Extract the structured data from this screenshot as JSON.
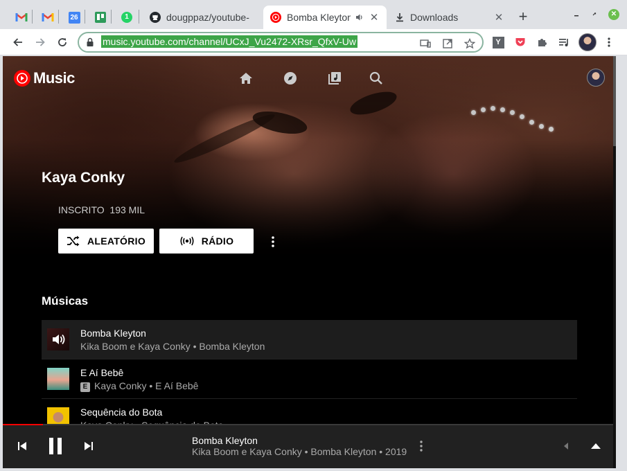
{
  "browser": {
    "tabs": [
      {
        "title": "dougppaz/youtube-",
        "icon": "github-icon"
      },
      {
        "title": "Bomba Kleyton",
        "icon": "youtube-music-icon",
        "audio_icon": "speaker-icon"
      },
      {
        "title": "Downloads",
        "icon": "download-icon"
      }
    ],
    "pinned_tabs": [
      "gmail-icon",
      "gmail-alt-icon",
      "calendar-icon",
      "trello-icon",
      "whatsapp-icon"
    ],
    "calendar_day": "26",
    "whatsapp_badge": "1",
    "url": "music.youtube.com/channel/UCxJ_Vu2472-XRsr_QfxV-Uw",
    "extensions": [
      "y-extension-icon",
      "pocket-icon",
      "extensions-puzzle-icon",
      "media-playlist-icon"
    ],
    "ext_y_label": "Y"
  },
  "app": {
    "logo_text": "Music",
    "nav_icons": [
      "home-icon",
      "explore-icon",
      "library-icon",
      "search-icon"
    ]
  },
  "artist": {
    "name": "Kaya Conky",
    "subscribe_state": "INSCRITO",
    "subscriber_count": "193 MIL",
    "shuffle_label": "ALEATÓRIO",
    "radio_label": "RÁDIO"
  },
  "songs_section": {
    "title": "Músicas",
    "items": [
      {
        "title": "Bomba Kleyton",
        "subtitle": "Kika Boom e Kaya Conky • Bomba Kleyton",
        "playing": true,
        "explicit": false
      },
      {
        "title": "E Aí Bebê",
        "subtitle": "Kaya Conky • E Aí Bebê",
        "playing": false,
        "explicit": true,
        "explicit_badge": "E"
      },
      {
        "title": "Sequência do Bota",
        "subtitle": "Kaya Conky • Sequência do Bota",
        "playing": false,
        "explicit": false
      }
    ]
  },
  "player": {
    "title": "Bomba Kleyton",
    "subtitle": "Kika Boom e Kaya Conky • Bomba Kleyton • 2019",
    "progress": 0.065,
    "accent_color": "#ff0000"
  }
}
